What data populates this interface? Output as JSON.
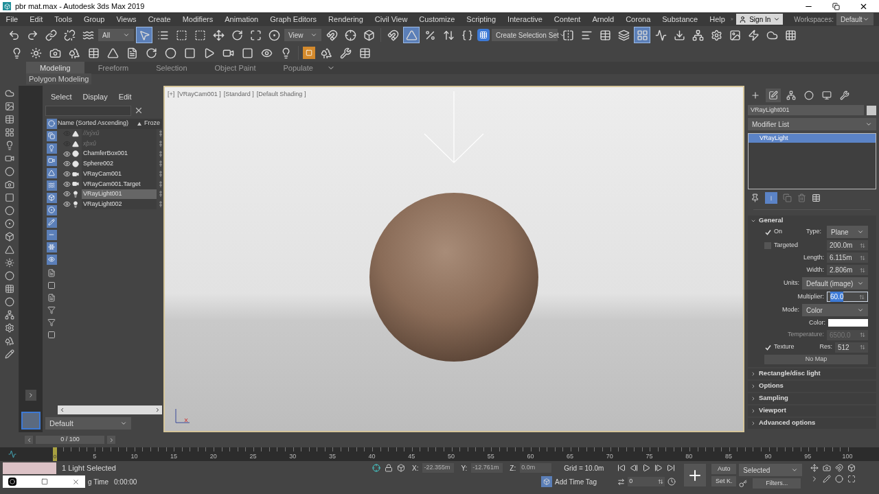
{
  "window": {
    "title": "pbr mat.max - Autodesk 3ds Max 2019"
  },
  "menu": [
    "File",
    "Edit",
    "Tools",
    "Group",
    "Views",
    "Create",
    "Modifiers",
    "Animation",
    "Graph Editors",
    "Rendering",
    "Civil View",
    "Customize",
    "Scripting",
    "Interactive",
    "Content",
    "Arnold",
    "Corona",
    "Substance",
    "Help"
  ],
  "account": {
    "sign_in": "Sign In",
    "workspaces_label": "Workspaces:",
    "workspace": "Default"
  },
  "toolbar": {
    "selection_filter": "All",
    "reference_coord": "View",
    "selection_set": "Create Selection Set"
  },
  "ribbon": {
    "tabs": [
      {
        "label": "Modeling",
        "selected": true
      },
      {
        "label": "Freeform",
        "selected": false
      },
      {
        "label": "Selection",
        "selected": false
      },
      {
        "label": "Object Paint",
        "selected": false
      },
      {
        "label": "Populate",
        "selected": false
      }
    ],
    "panel": "Polygon Modeling"
  },
  "explorer": {
    "menu": [
      "Select",
      "Display",
      "Edit"
    ],
    "columns": [
      "Name (Sorted Ascending)",
      "Froze"
    ],
    "rows": [
      {
        "name": "//xýxû",
        "kind": "helper",
        "visible": false,
        "selected": false
      },
      {
        "name": "xþxû",
        "kind": "helper",
        "visible": false,
        "selected": false
      },
      {
        "name": "ChamferBox001",
        "kind": "geometry",
        "visible": true,
        "selected": false
      },
      {
        "name": "Sphere002",
        "kind": "geometry",
        "visible": true,
        "selected": false
      },
      {
        "name": "VRayCam001",
        "kind": "camera",
        "visible": true,
        "selected": false
      },
      {
        "name": "VRayCam001.Target",
        "kind": "camera",
        "visible": true,
        "selected": false
      },
      {
        "name": "VRayLight001",
        "kind": "light",
        "visible": true,
        "selected": true
      },
      {
        "name": "VRayLight002",
        "kind": "light",
        "visible": true,
        "selected": false
      }
    ],
    "layer": "Default"
  },
  "viewport": {
    "labels": [
      "[+]",
      "[VRayCam001 ]",
      "[Standard ]",
      "[Default Shading ]"
    ]
  },
  "command_panel": {
    "object_name": "VRayLight001",
    "modifier_list": "Modifier List",
    "stack": [
      {
        "label": "VRayLight",
        "selected": true
      }
    ],
    "general": {
      "title": "General",
      "expanded": true,
      "on": {
        "label": "On",
        "checked": true
      },
      "type": {
        "label": "Type:",
        "value": "Plane"
      },
      "targeted": {
        "label": "Targeted",
        "checked": false,
        "value": "200.0m"
      },
      "length": {
        "label": "Length:",
        "value": "6.115m"
      },
      "width": {
        "label": "Width:",
        "value": "2.806m"
      },
      "units": {
        "label": "Units:",
        "value": "Default (image)"
      },
      "multiplier": {
        "label": "Multiplier:",
        "value": "60.0",
        "focused": true
      },
      "mode": {
        "label": "Mode:",
        "value": "Color"
      },
      "color": {
        "label": "Color:",
        "color": "#ffffff"
      },
      "temperature": {
        "label": "Temperature:",
        "value": "6500.0",
        "disabled": true
      },
      "texture": {
        "label": "Texture",
        "checked": true
      },
      "res": {
        "label": "Res:",
        "value": "512"
      },
      "map_button": "No Map"
    },
    "rollouts": [
      {
        "title": "Rectangle/disc light",
        "expanded": false
      },
      {
        "title": "Options",
        "expanded": false
      },
      {
        "title": "Sampling",
        "expanded": false
      },
      {
        "title": "Viewport",
        "expanded": false
      },
      {
        "title": "Advanced options",
        "expanded": false
      }
    ]
  },
  "timeline": {
    "range": "0 / 100",
    "frame": "0",
    "level": 0,
    "ticks": [
      "5",
      "10",
      "15",
      "20",
      "25",
      "30",
      "35",
      "40",
      "45",
      "50",
      "55",
      "60",
      "65",
      "70",
      "75",
      "80",
      "85",
      "90",
      "95",
      "100"
    ]
  },
  "status": {
    "selection": "1 Light Selected",
    "prompt": "g Time",
    "time": "0:00:00",
    "x_label": "X:",
    "x": "-22.355m",
    "y_label": "Y:",
    "y": "-12.761m",
    "z_label": "Z:",
    "z": "0.0m",
    "grid": "Grid = 10.0m",
    "add_time_tag": "Add Time Tag",
    "current_frame": "0",
    "auto_key": "Auto",
    "key_filter": "Selected",
    "set_key": "Set K.",
    "filters": "Filters..."
  }
}
